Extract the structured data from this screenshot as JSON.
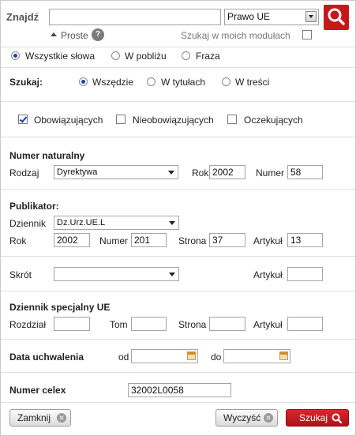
{
  "search": {
    "label": "Znajdź",
    "query_value": "",
    "scope_select": "Prawo UE",
    "simple_label": "Proste",
    "my_modules_label": "Szukaj w moich modułach",
    "my_modules_checked": false
  },
  "match_mode": {
    "options": [
      "Wszystkie słowa",
      "W pobliżu",
      "Fraza"
    ],
    "selected": "Wszystkie słowa"
  },
  "scope": {
    "label": "Szukaj:",
    "options": [
      "Wszędzie",
      "W tytułach",
      "W treści"
    ],
    "selected": "Wszędzie"
  },
  "status_filters": [
    {
      "label": "Obowiązujących",
      "checked": true
    },
    {
      "label": "Nieobowiązujących",
      "checked": false
    },
    {
      "label": "Oczekujących",
      "checked": false
    }
  ],
  "natural_number": {
    "heading": "Numer naturalny",
    "type_label": "Rodzaj",
    "type_value": "Dyrektywa",
    "year_label": "Rok",
    "year_value": "2002",
    "number_label": "Numer",
    "number_value": "58"
  },
  "publisher": {
    "heading": "Publikator:",
    "journal_label": "Dziennik",
    "journal_value": "Dz.Urz.UE.L",
    "year_label": "Rok",
    "year_value": "2002",
    "number_label": "Numer",
    "number_value": "201",
    "page_label": "Strona",
    "page_value": "37",
    "article_label": "Artykuł",
    "article_value": "13"
  },
  "abbrev": {
    "label": "Skrót",
    "value": "",
    "article_label": "Artykuł",
    "article_value": ""
  },
  "special_journal": {
    "heading": "Dziennik specjalny UE",
    "chapter_label": "Rozdział",
    "chapter_value": "",
    "volume_label": "Tom",
    "volume_value": "",
    "page_label": "Strona",
    "page_value": "",
    "article_label": "Artykuł",
    "article_value": ""
  },
  "adoption_date": {
    "heading": "Data uchwalenia",
    "from_label": "od",
    "from_value": "",
    "to_label": "do",
    "to_value": ""
  },
  "celex": {
    "heading": "Numer celex",
    "value": "32002L0058"
  },
  "buttons": {
    "close": "Zamknij",
    "clear": "Wyczyść",
    "search": "Szukaj"
  },
  "colors": {
    "accent_red": "#c8161d",
    "radio_blue": "#1d3fa8",
    "divider": "#e0e0e0"
  }
}
